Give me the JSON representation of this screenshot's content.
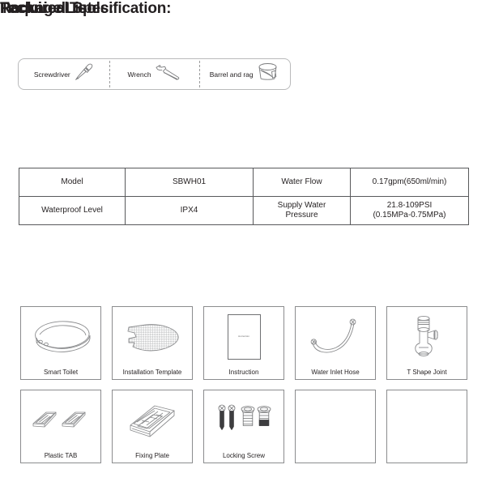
{
  "sections": {
    "tools_title": "Required Tools:",
    "spec_title": "Technical Specification:",
    "package_title": "Package List:"
  },
  "tools": [
    {
      "label": "Screwdriver",
      "icon": "screwdriver-icon"
    },
    {
      "label": "Wrench",
      "icon": "wrench-icon"
    },
    {
      "label": "Barrel and rag",
      "icon": "barrel-and-rag-icon"
    }
  ],
  "spec_table": {
    "rows": [
      [
        {
          "text": "Model"
        },
        {
          "text": "SBWH01"
        },
        {
          "text": "Water Flow"
        },
        {
          "text": "0.17gpm(650ml/min)"
        }
      ],
      [
        {
          "text": "Waterproof Level"
        },
        {
          "text": "IPX4"
        },
        {
          "text": "Supply Water\nPressure"
        },
        {
          "text": "21.8-109PSI\n(0.15MPa-0.75MPa)"
        }
      ]
    ]
  },
  "package_list": {
    "items": [
      {
        "label": "Smart Toilet",
        "icon": "smart-toilet-icon",
        "empty": false
      },
      {
        "label": "Installation Template",
        "icon": "installation-template-icon",
        "empty": false
      },
      {
        "label": "Instruction",
        "icon": "instruction-booklet-icon",
        "inner_text": "instruction",
        "empty": false
      },
      {
        "label": "Water Inlet Hose",
        "icon": "water-inlet-hose-icon",
        "empty": false
      },
      {
        "label": "T Shape Joint",
        "icon": "t-shape-joint-icon",
        "empty": false
      },
      {
        "label": "Plastic TAB",
        "icon": "plastic-tab-icon",
        "empty": false
      },
      {
        "label": "Fixing Plate",
        "icon": "fixing-plate-icon",
        "empty": false
      },
      {
        "label": "Locking Screw",
        "icon": "locking-screw-icon",
        "empty": false
      },
      {
        "label": "",
        "icon": "empty-slot",
        "empty": true
      },
      {
        "label": "",
        "icon": "empty-slot",
        "empty": true
      }
    ]
  },
  "colors": {
    "text": "#231f20",
    "table_border": "#58595b",
    "card_border": "#8b8c8e",
    "tools_border": "#b9babb",
    "line_art": "#6f7072"
  }
}
